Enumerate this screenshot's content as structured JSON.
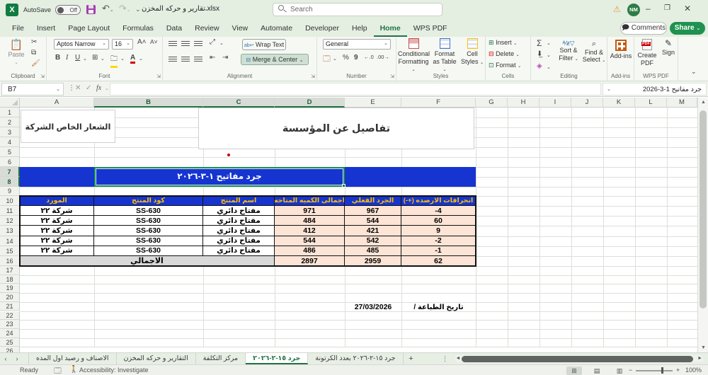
{
  "app": {
    "autosave_label": "AutoSave",
    "autosave_state": "Off",
    "filename": "تقارير و حركه المخزن.xlsx",
    "search_placeholder": "Search",
    "avatar_initials": "NM",
    "comments_label": "Comments",
    "share_label": "Share"
  },
  "menu": {
    "tabs": [
      "File",
      "Insert",
      "Page Layout",
      "Formulas",
      "Data",
      "Review",
      "View",
      "Automate",
      "Developer",
      "Help",
      "Home",
      "WPS PDF"
    ],
    "active_tab": "Home"
  },
  "ribbon": {
    "clipboard_group": "Clipboard",
    "paste_label": "Paste",
    "font_group": "Font",
    "font_name": "Aptos Narrow",
    "font_size": "16",
    "bold": "B",
    "italic": "I",
    "underline": "U",
    "alignment_group": "Alignment",
    "wrap_text": "Wrap Text",
    "merge_center": "Merge & Center",
    "number_group": "Number",
    "number_format": "General",
    "percent": "%",
    "comma": "9",
    "styles_group": "Styles",
    "conditional_formatting": "Conditional Formatting",
    "format_as_table": "Format as Table",
    "cell_styles": "Cell Styles",
    "cells_group": "Cells",
    "insert": "Insert",
    "delete": "Delete",
    "format": "Format",
    "editing_group": "Editing",
    "autosum": "Σ",
    "sort_filter": "Sort & Filter",
    "find_select": "Find & Select",
    "addins_group": "Add-ins",
    "addins_label": "Add-ins",
    "wpspdf_group": "WPS PDF",
    "create_pdf": "Create PDF",
    "sign": "Sign"
  },
  "formula_bar": {
    "name_box": "B7",
    "fx_label": "fx",
    "sheet_selector": "جرد مفاتيح  1-3-2026"
  },
  "grid": {
    "columns": [
      "A",
      "B",
      "C",
      "D",
      "E",
      "F",
      "G",
      "H",
      "I",
      "J",
      "K",
      "L",
      "M"
    ],
    "selected_columns": [
      "B",
      "C",
      "D"
    ],
    "selected_rows": [
      7,
      8
    ],
    "row_count": 26
  },
  "cells": {
    "logo_box": "الشعار الخاص الشركة",
    "details_box": "تفاصيل عن المؤسسة",
    "banner_title": "جرد مفاتيح ١-٣-٢٠٢٦",
    "print_date": "27/03/2026",
    "print_date_label": "تاريخ الطباعة /"
  },
  "inventory_table": {
    "headers": [
      "المورد",
      "كود المنتج",
      "اسم المنتج",
      "اجمالى الكميه المتاحه",
      "الجرد الفعلي",
      "انحرافات الارصده (+-)"
    ],
    "rows": [
      [
        "شركة ٢٢",
        "SS-630",
        "مفتاح دائري",
        "971",
        "967",
        "-4"
      ],
      [
        "شركة ٢٢",
        "SS-630",
        "مفتاح دائري",
        "484",
        "544",
        "60"
      ],
      [
        "شركة ٢٢",
        "SS-630",
        "مفتاح دائري",
        "412",
        "421",
        "9"
      ],
      [
        "شركة ٢٢",
        "SS-630",
        "مفتاح دائري",
        "544",
        "542",
        "-2"
      ],
      [
        "شركة ٢٢",
        "SS-630",
        "مفتاح دائري",
        "486",
        "485",
        "-1"
      ]
    ],
    "total_label": "الاجمالي",
    "totals": [
      "2897",
      "2959",
      "62"
    ]
  },
  "sheet_tabs": {
    "labels": [
      "الاصناف و رصيد اول المده",
      "التقارير و حركه المخزن",
      "مركز التكلفة",
      "جرد ١٥-٢-٢٠٢٦",
      "جرد ١٥-٢-٢٠٢٦ بعدد الكرتونة"
    ],
    "active_index": 3,
    "add_label": "+"
  },
  "status_bar": {
    "ready": "Ready",
    "accessibility": "Accessibility: Investigate",
    "zoom_level": "100%"
  },
  "colors": {
    "banner_blue": "#1634d0",
    "header_gold": "#ffc000",
    "peach_fill": "#fce4d6",
    "total_gray": "#d9d9d9",
    "excel_green": "#217346",
    "share_green": "#1f9150"
  }
}
